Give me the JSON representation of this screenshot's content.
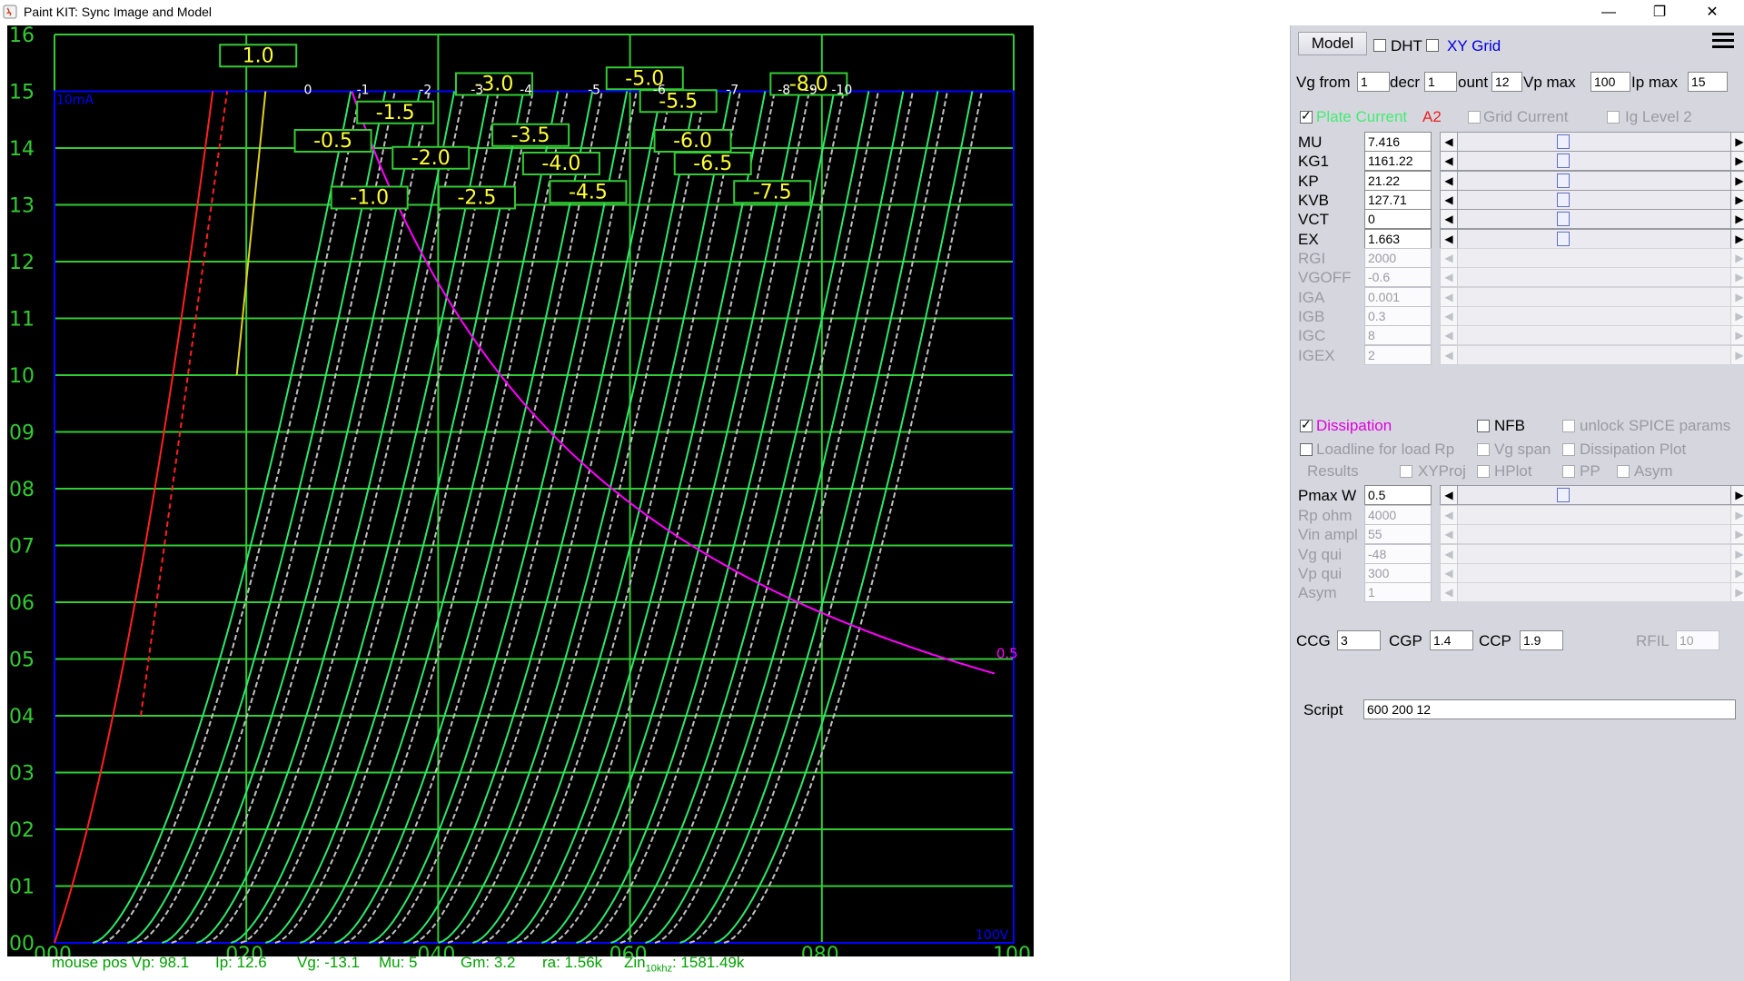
{
  "window": {
    "title": "Paint KIT: Sync Image and Model",
    "minimize": "—",
    "restore": "❐",
    "close": "✕"
  },
  "plot": {
    "y_ticks": [
      "16",
      "15",
      "14",
      "13",
      "12",
      "11",
      "10",
      "09",
      "08",
      "07",
      "06",
      "05",
      "04",
      "03",
      "02",
      "01",
      "00"
    ],
    "x_ticks": [
      "000",
      "020",
      "040",
      "060",
      "080",
      "100"
    ],
    "y_unit_label": "10mA",
    "x_unit_label": "100V",
    "dissipation_label": "0.5",
    "curve_labels": [
      "1.0",
      "-0.5",
      "-1.0",
      "-1.5",
      "-2.0",
      "-2.5",
      "-3.0",
      "-3.5",
      "-4.0",
      "-4.5",
      "-5.0",
      "-5.5",
      "-6.0",
      "-6.5",
      "-7.5",
      "-8.0"
    ],
    "small_labels": [
      "-1",
      "-2",
      "-3",
      "-4",
      "-5",
      "-6",
      "-7",
      "-8",
      "-9",
      "-10",
      "0"
    ],
    "colors": {
      "grid": "#33cc33",
      "frame": "#0000ff",
      "model": "#2ee86b",
      "image": "#c0c0c0",
      "dissipation": "#ff00ff",
      "label": "#ffff33",
      "red": "#ff2020",
      "yellow": "#e0d020"
    }
  },
  "status": {
    "mouse_pos": "mouse pos Vp: 98.1",
    "ip": "Ip: 12.6",
    "vg": "Vg: -13.1",
    "mu": "Mu: 5",
    "gm": "Gm: 3.2",
    "ra": "ra: 1.56k",
    "zin_prefix": "Zin",
    "zin_sub": "10khz",
    "zin_value": ": 1581.49k"
  },
  "panel": {
    "model_button": "Model",
    "dht_label": "DHT",
    "xygrid_label": "XY Grid",
    "vg_from_label": "Vg from",
    "vg_from": "1",
    "decr_label": "decr",
    "decr": "1",
    "count_label": "ount",
    "count": "12",
    "vpmax_label": "Vp max",
    "vpmax": "100",
    "ipmax_label": "Ip max",
    "ipmax": "15",
    "plate_current_label": "Plate Current",
    "a2_label": "A2",
    "grid_current_label": "Grid Current",
    "ig_level_label": "Ig Level 2",
    "params": [
      {
        "name": "MU",
        "value": "7.416"
      },
      {
        "name": "KG1",
        "value": "1161.22"
      },
      {
        "name": "KP",
        "value": "21.22"
      },
      {
        "name": "KVB",
        "value": "127.71"
      },
      {
        "name": "VCT",
        "value": "0"
      },
      {
        "name": "EX",
        "value": "1.663"
      }
    ],
    "dim_params": [
      {
        "name": "RGI",
        "value": "2000"
      },
      {
        "name": "VGOFF",
        "value": "-0.6"
      },
      {
        "name": "IGA",
        "value": "0.001"
      },
      {
        "name": "IGB",
        "value": "0.3"
      },
      {
        "name": "IGC",
        "value": "8"
      },
      {
        "name": "IGEX",
        "value": "2"
      }
    ],
    "dissipation_label": "Dissipation",
    "nfb_label": "NFB",
    "unlock_label": "unlock SPICE params",
    "loadline_label": "Loadline for load Rp",
    "vgspan_label": "Vg span",
    "dissplot_label": "Dissipation Plot",
    "results_label": "Results",
    "xyproj_label": "XYProj",
    "hplot_label": "HPlot",
    "pp_label": "PP",
    "asym_label": "Asym",
    "pmax_label": "Pmax W",
    "pmax": "0.5",
    "load_params": [
      {
        "name": "Rp ohm",
        "value": "4000"
      },
      {
        "name": "Vin ampl",
        "value": "55"
      },
      {
        "name": "Vg qui",
        "value": "-48"
      },
      {
        "name": "Vp qui",
        "value": "300"
      },
      {
        "name": "Asym",
        "value": "1"
      }
    ],
    "ccg_label": "CCG",
    "ccg": "3",
    "cgp_label": "CGP",
    "cgp": "1.4",
    "ccp_label": "CCP",
    "ccp": "1.9",
    "rfil_label": "RFIL",
    "rfil": "10",
    "script_label": "Script",
    "script": "600 200 12"
  }
}
